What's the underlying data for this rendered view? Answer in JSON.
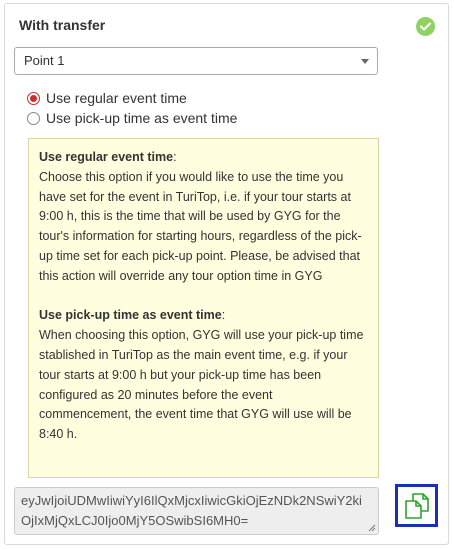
{
  "section": {
    "title": "With transfer",
    "status_icon": "check-circle-icon",
    "status_color": "#8fd163"
  },
  "pickup_select": {
    "selected": "Point 1"
  },
  "event_time_options": [
    {
      "label": "Use regular event time",
      "checked": true
    },
    {
      "label": "Use pick-up time as event time",
      "checked": false
    }
  ],
  "help": {
    "regular_heading": "Use regular event time",
    "regular_text": "Choose this option if you would like to use the time you have set for the event in TuriTop, i.e. if your tour starts at 9:00 h, this is the time that will be used by GYG for the tour's information for starting hours, regardless of the pick-up time set for each pick-up point. Please, be advised that this action will override any tour option time in GYG",
    "pickup_heading": "Use pick-up time as event time",
    "pickup_text": "When choosing this option, GYG will use your pick-up time stablished in TuriTop as the main event time, e.g. if your tour starts at 9:00 h but your pick-up time has been configured as 20 minutes before the event commencement, the event time that GYG will use will be 8:40 h.",
    "box_color": "#ffffe0"
  },
  "code": {
    "value": "eyJwIjoiUDMwIiwiYyI6IlQxMjcxIiwicGkiOjEzNDk2NSwiY2kiOjIxMjQxLCJ0Ijo0MjY5OSwibSI6MH0="
  },
  "copy_button": {
    "icon": "copy-icon",
    "icon_color": "#2aa52a",
    "highlight_color": "#1a2fb8"
  }
}
